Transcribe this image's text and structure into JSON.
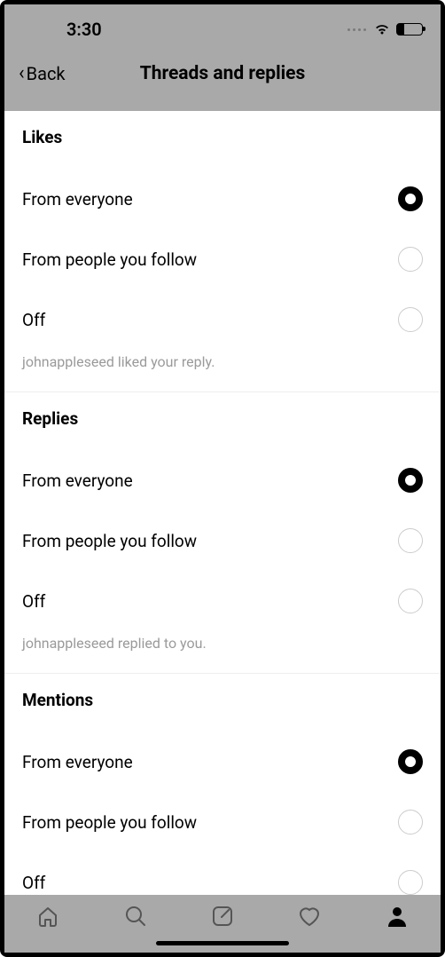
{
  "status": {
    "time": "3:30"
  },
  "nav": {
    "back_label": "Back",
    "title": "Threads and replies"
  },
  "sections": {
    "likes": {
      "title": "Likes",
      "opt_everyone": "From everyone",
      "opt_following": "From people you follow",
      "opt_off": "Off",
      "hint": "johnappleseed liked your reply.",
      "selected": "everyone"
    },
    "replies": {
      "title": "Replies",
      "opt_everyone": "From everyone",
      "opt_following": "From people you follow",
      "opt_off": "Off",
      "hint": "johnappleseed replied to you.",
      "selected": "everyone"
    },
    "mentions": {
      "title": "Mentions",
      "opt_everyone": "From everyone",
      "opt_following": "From people you follow",
      "opt_off": "Off",
      "selected": "everyone"
    }
  }
}
